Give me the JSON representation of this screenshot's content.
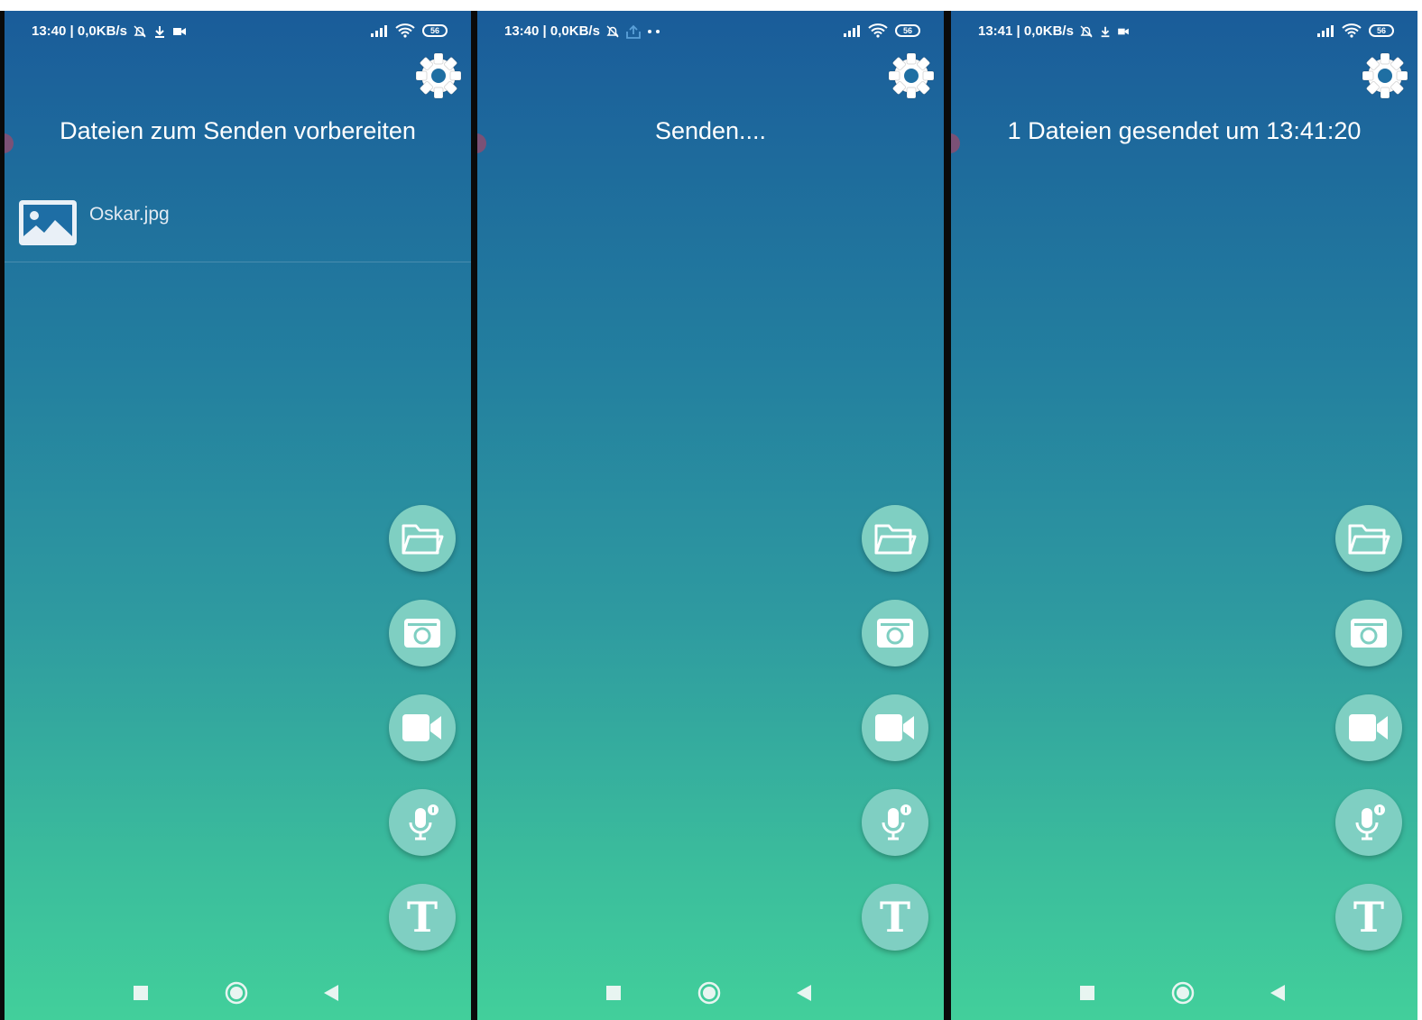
{
  "screens": [
    {
      "status": {
        "time_speed": "13:40 | 0,0KB/s",
        "battery": "56"
      },
      "title": "Dateien zum Senden vorbereiten",
      "file": {
        "name": "Oskar.jpg"
      }
    },
    {
      "status": {
        "time_speed": "13:40 | 0,0KB/s",
        "battery": "56"
      },
      "title": "Senden...."
    },
    {
      "status": {
        "time_speed": "13:41 | 0,0KB/s",
        "battery": "56"
      },
      "title": "1 Dateien gesendet um 13:41:20"
    }
  ],
  "icons": {
    "settings": "gear-icon",
    "fabs": [
      "folder-icon",
      "camera-icon",
      "video-camera-icon",
      "microphone-icon",
      "text-icon"
    ],
    "text_fab_glyph": "T",
    "nav": [
      "recents-square-icon",
      "home-circle-icon",
      "back-triangle-icon"
    ]
  },
  "colors": {
    "gradient_top": "#1a5c9a",
    "gradient_bottom": "#42cf9b",
    "fab": "#7fcfc2"
  }
}
